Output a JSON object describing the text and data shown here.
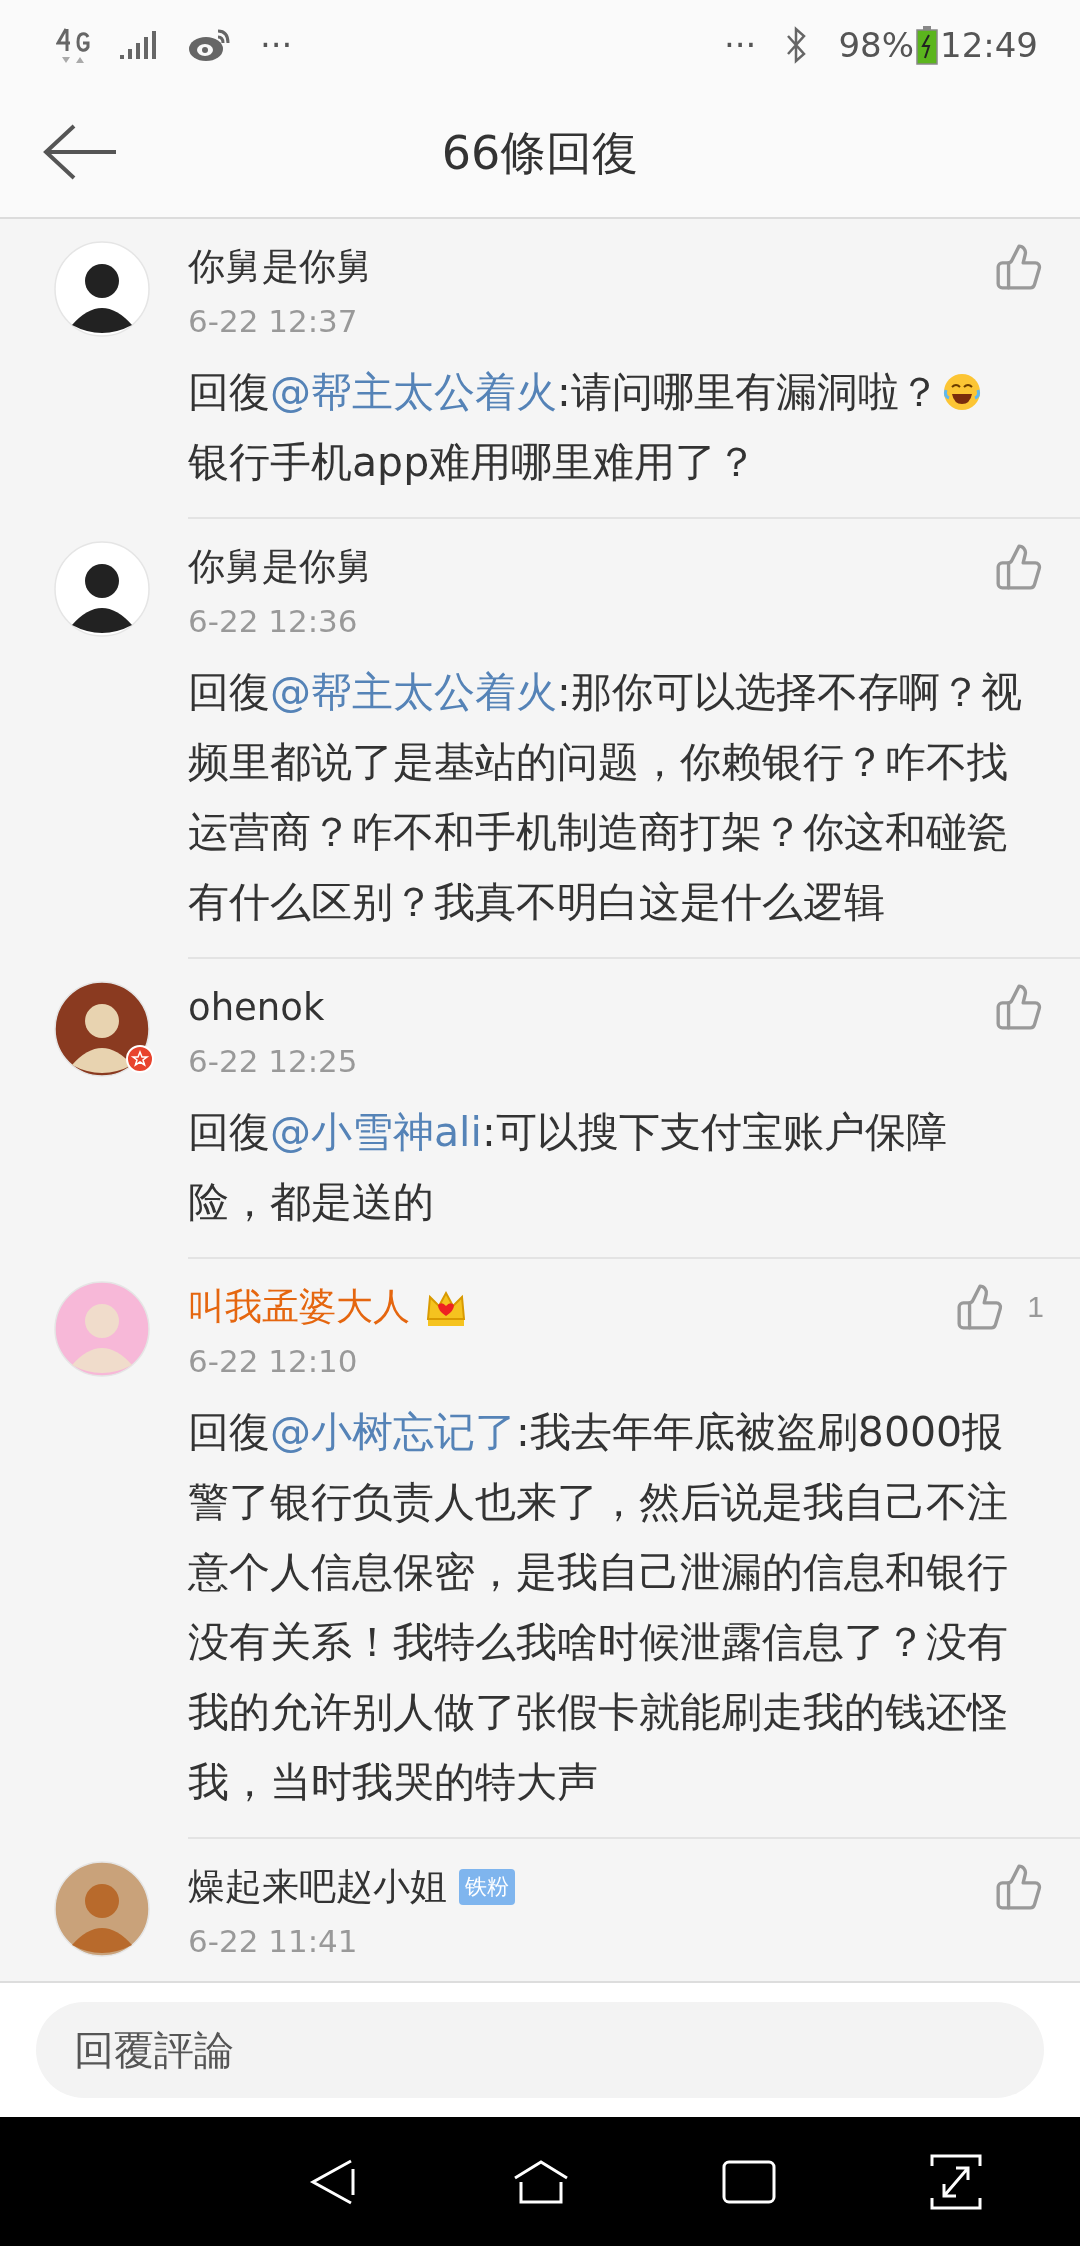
{
  "status_bar": {
    "left_more": "···",
    "right_more": "···",
    "battery": "98%",
    "time": "12:49"
  },
  "header": {
    "title": "66條回復"
  },
  "comments": [
    {
      "name": "你舅是你舅",
      "vip": false,
      "verified": false,
      "time": "6-22 12:37",
      "content": [
        {
          "kind": "text",
          "text": "回復"
        },
        {
          "kind": "mention",
          "text": "@帮主太公着火"
        },
        {
          "kind": "text",
          "text": ":请问哪里有漏洞啦？"
        },
        {
          "kind": "emoji"
        },
        {
          "kind": "text",
          "text": "银行手机app难用哪里难用了？"
        }
      ]
    },
    {
      "name": "你舅是你舅",
      "vip": false,
      "verified": false,
      "time": "6-22 12:36",
      "content": [
        {
          "kind": "text",
          "text": "回復"
        },
        {
          "kind": "mention",
          "text": "@帮主太公着火"
        },
        {
          "kind": "text",
          "text": ":那你可以选择不存啊？视频里都说了是基站的问题，你赖银行？咋不找运营商？咋不和手机制造商打架？你这和碰瓷有什么区别？我真不明白这是什么逻辑"
        }
      ]
    },
    {
      "name": "ohenok",
      "vip": false,
      "verified": true,
      "time": "6-22 12:25",
      "content": [
        {
          "kind": "text",
          "text": "回復"
        },
        {
          "kind": "mention",
          "text": "@小雪神ali"
        },
        {
          "kind": "text",
          "text": ":可以搜下支付宝账户保障险，都是送的"
        }
      ]
    },
    {
      "name": "叫我孟婆大人",
      "vip": true,
      "verified": false,
      "badge": {
        "kind": "crown"
      },
      "likes": "1",
      "time": "6-22 12:10",
      "content": [
        {
          "kind": "text",
          "text": "回復"
        },
        {
          "kind": "mention",
          "text": "@小树忘记了"
        },
        {
          "kind": "text",
          "text": ":我去年年底被盗刷8000报警了银行负责人也来了，然后说是我自己不注意个人信息保密，是我自己泄漏的信息和银行没有关系！我特么我啥时候泄露信息了？没有我的允许别人做了张假卡就能刷走我的钱还怪我，当时我哭的特大声"
        }
      ]
    },
    {
      "name": "燥起来吧赵小姐",
      "vip": false,
      "verified": false,
      "badge": {
        "kind": "fan",
        "label": "铁粉"
      },
      "time": "6-22 11:41"
    }
  ],
  "reply_box": {
    "placeholder": "回覆評論"
  }
}
